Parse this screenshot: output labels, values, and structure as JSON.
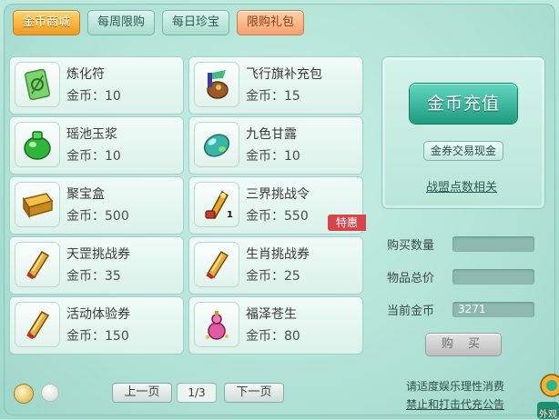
{
  "tabs": [
    {
      "label": "金币商城"
    },
    {
      "label": "每周限购"
    },
    {
      "label": "每日珍宝"
    },
    {
      "label": "限购礼包"
    }
  ],
  "items": [
    {
      "name": "炼化符",
      "price": "金币：10",
      "icon": "talisman-icon"
    },
    {
      "name": "飞行旗补充包",
      "price": "金币：15",
      "icon": "flag-pack-icon"
    },
    {
      "name": "瑶池玉浆",
      "price": "金币：10",
      "icon": "jade-potion-icon"
    },
    {
      "name": "九色甘露",
      "price": "金币：10",
      "icon": "nectar-icon"
    },
    {
      "name": "聚宝盒",
      "price": "金币：500",
      "icon": "treasure-box-icon"
    },
    {
      "name": "三界挑战令",
      "price": "金币：550",
      "icon": "challenge-token-icon",
      "qty": "1",
      "tag": "特惠"
    },
    {
      "name": "天罡挑战券",
      "price": "金币：35",
      "icon": "scroll-icon"
    },
    {
      "name": "生肖挑战券",
      "price": "金币：25",
      "icon": "scroll-icon"
    },
    {
      "name": "活动体验券",
      "price": "金币：150",
      "icon": "scroll-icon"
    },
    {
      "name": "福泽苍生",
      "price": "金币：80",
      "icon": "gourd-icon"
    }
  ],
  "panel": {
    "recharge_label": "金币充值",
    "exchange_label": "金券交易现金",
    "alliance_label": "战盟点数相关"
  },
  "purchase": {
    "qty_label": "购买数量",
    "qty_value": "",
    "total_label": "物品总价",
    "total_value": "",
    "gold_label": "当前金币",
    "gold_value": "3271",
    "buy_label": "购 买"
  },
  "pager": {
    "prev_label": "上一页",
    "page": "1/3",
    "next_label": "下一页"
  },
  "notices": {
    "line1": "请适度娱乐理性消费",
    "line2": "禁止和打击代充公告"
  },
  "corner_label": "外观",
  "colors": {
    "active_tab": "#ee9a23",
    "recharge_button": "#1e9b80",
    "special_tag": "#d6454a"
  }
}
